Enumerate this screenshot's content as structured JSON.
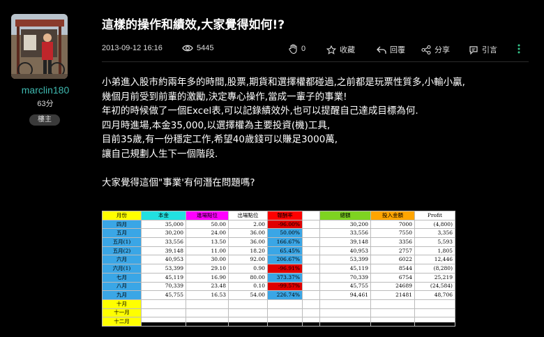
{
  "author": {
    "username": "marclin180",
    "score": "63分",
    "badge": "樓主"
  },
  "post": {
    "title": "這樣的操作和績效,大家覺得如何!?",
    "date": "2013-09-12 16:16",
    "views": "5445",
    "likes": "0",
    "actions": {
      "favorite": "收藏",
      "reply": "回覆",
      "share": "分享",
      "quote": "引言"
    },
    "body_lines": [
      "小弟進入股市約兩年多的時間,股票,期貨和選擇權都碰過,之前都是玩票性質多,小輸小贏,",
      "幾個月前受到前輩的激勵,決定專心操作,當成一輩子的事業!",
      "年初的時候做了一個Excel表,可以記錄績效外,也可以提醒自己達成目標為何.",
      "四月時進場,本金35,000,以選擇權為主要投資(機)工具,",
      "目前35歲,有一份穩定工作,希望40歲錢可以賺足3000萬,",
      "讓自己規劃人生下一個階段."
    ],
    "question": "大家覺得這個\"事業'有何潛在問題嗎?"
  },
  "table": {
    "headers": [
      "月份",
      "本金",
      "進場點位",
      "出場點位",
      "報酬率",
      "",
      "總額",
      "投入金額",
      "Profit"
    ],
    "header_colors": [
      "#ffff00",
      "#22e0e0",
      "#ff00ff",
      "#ffffff",
      "#ff0000",
      "#ffffff",
      "#7ed321",
      "#ffa500",
      "#ffffff"
    ],
    "rows": [
      {
        "month": "四月",
        "principal": "35,000",
        "entry": "50.00",
        "exit": "2.00",
        "ret": "-96.00%",
        "total": "30,200",
        "invest": "7000",
        "profit": "(4,800)",
        "ret_bg": "red",
        "profit_color": "neg"
      },
      {
        "month": "五月",
        "principal": "30,200",
        "entry": "24.00",
        "exit": "36.00",
        "ret": "50.00%",
        "total": "33,556",
        "invest": "7550",
        "profit": "3,356",
        "ret_bg": "blue",
        "profit_color": "pos"
      },
      {
        "month": "五月(1)",
        "principal": "33,556",
        "entry": "13.50",
        "exit": "36.00",
        "ret": "166.67%",
        "total": "39,148",
        "invest": "3356",
        "profit": "5,593",
        "ret_bg": "blue",
        "profit_color": "pos"
      },
      {
        "month": "五月(2)",
        "principal": "39,148",
        "entry": "11.00",
        "exit": "18.20",
        "ret": "65.45%",
        "total": "40,953",
        "invest": "2757",
        "profit": "1,805",
        "ret_bg": "blue",
        "profit_color": "pos"
      },
      {
        "month": "六月",
        "principal": "40,953",
        "entry": "30.00",
        "exit": "92.00",
        "ret": "206.67%",
        "total": "53,399",
        "invest": "6022",
        "profit": "12,446",
        "ret_bg": "blue",
        "profit_color": "pos"
      },
      {
        "month": "六月(1)",
        "principal": "53,399",
        "entry": "29.10",
        "exit": "0.90",
        "ret": "-96.91%",
        "total": "45,119",
        "invest": "8544",
        "profit": "(8,280)",
        "ret_bg": "red",
        "profit_color": "neg"
      },
      {
        "month": "七月",
        "principal": "45,119",
        "entry": "16.90",
        "exit": "80.00",
        "ret": "373.37%",
        "total": "70,339",
        "invest": "6754",
        "profit": "25,219",
        "ret_bg": "blue",
        "profit_color": "pos"
      },
      {
        "month": "八月",
        "principal": "70,339",
        "entry": "23.48",
        "exit": "0.10",
        "ret": "-99.57%",
        "total": "45,755",
        "invest": "24689",
        "profit": "(24,584)",
        "ret_bg": "red",
        "profit_color": "neg"
      },
      {
        "month": "九月",
        "principal": "45,755",
        "entry": "16.53",
        "exit": "54.00",
        "ret": "226.74%",
        "total": "94,461",
        "invest": "21481",
        "profit": "48,706",
        "ret_bg": "blue",
        "profit_color": "pos"
      },
      {
        "month": "十月",
        "principal": "",
        "entry": "",
        "exit": "",
        "ret": "",
        "total": "",
        "invest": "",
        "profit": "",
        "ret_bg": "",
        "profit_color": ""
      },
      {
        "month": "十一月",
        "principal": "",
        "entry": "",
        "exit": "",
        "ret": "",
        "total": "",
        "invest": "",
        "profit": "",
        "ret_bg": "",
        "profit_color": ""
      },
      {
        "month": "十二月",
        "principal": "",
        "entry": "",
        "exit": "",
        "ret": "",
        "total": "",
        "invest": "",
        "profit": "",
        "ret_bg": "",
        "profit_color": ""
      }
    ]
  },
  "icons": {
    "views": "eye-icon",
    "likes": "hand-icon",
    "favorite": "bookmark-icon",
    "reply": "reply-arrow-icon",
    "share": "share-icon",
    "quote": "quote-icon",
    "more": "kebab-menu-icon"
  },
  "colors": {
    "username": "#3fb9b0",
    "more_icon": "#35c48a",
    "page_bg": "#000000"
  }
}
